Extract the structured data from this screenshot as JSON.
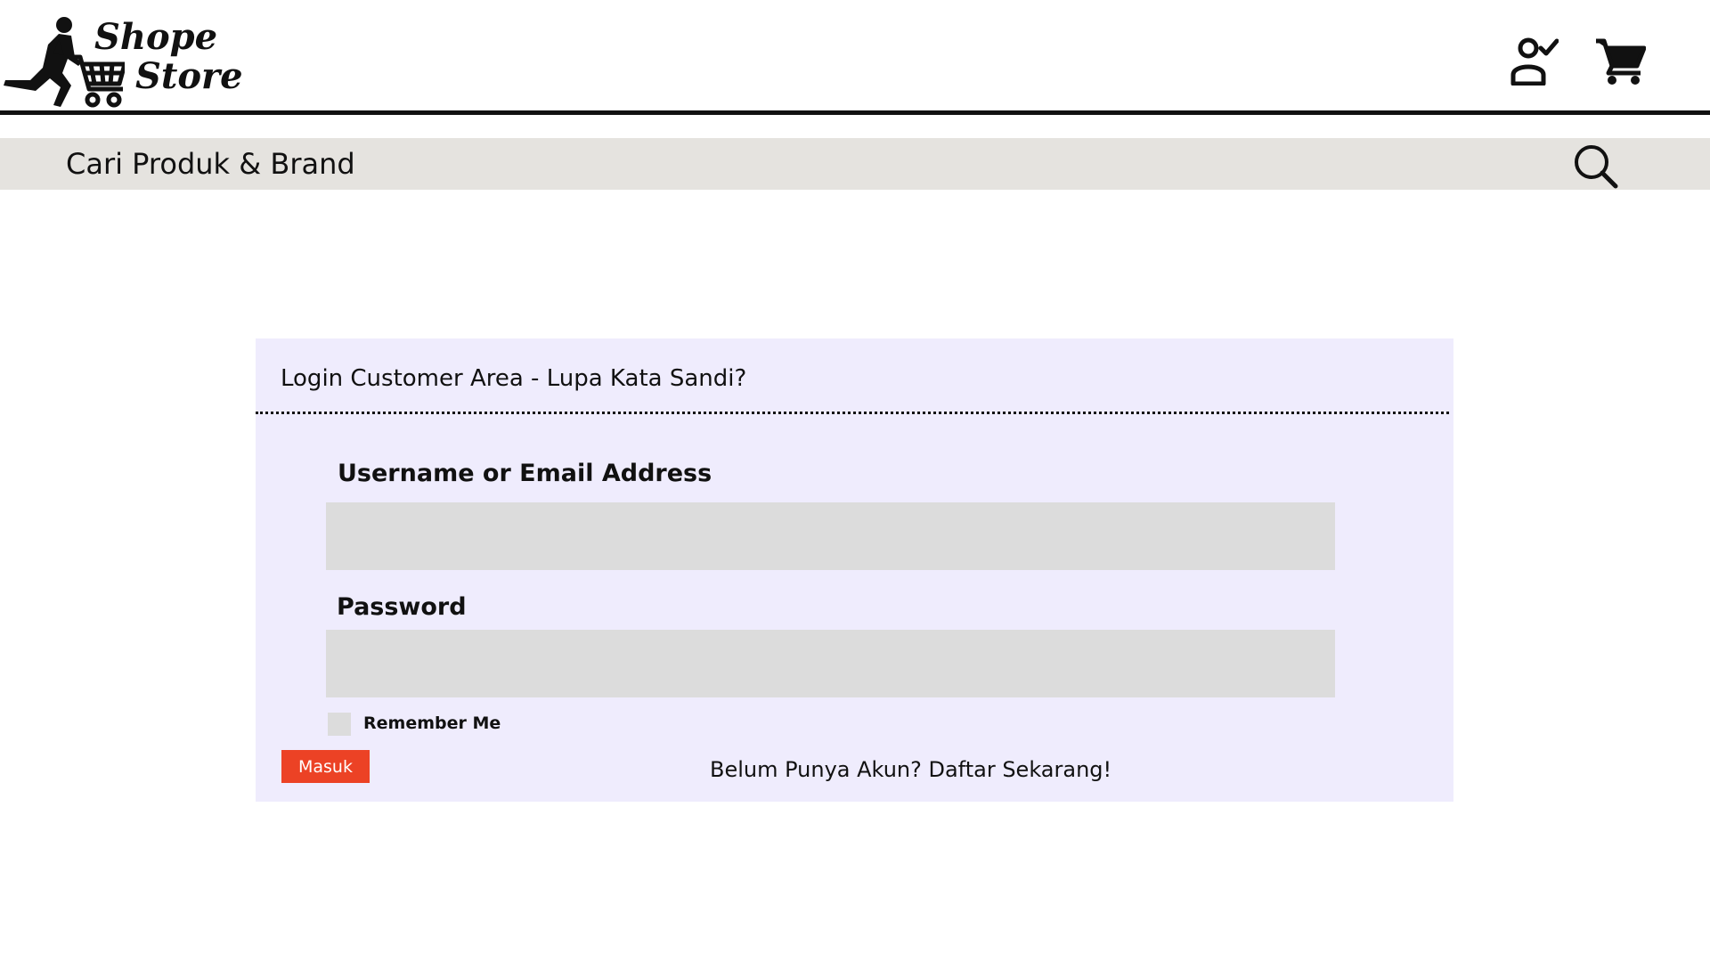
{
  "header": {
    "logo": {
      "line1": "Shope",
      "line2": "Store"
    },
    "icons": {
      "account": "user-check-icon",
      "cart": "shopping-cart-icon"
    }
  },
  "search": {
    "placeholder": "Cari Produk & Brand",
    "icon": "search-icon"
  },
  "login": {
    "title": "Login Customer Area",
    "title_separator": " - ",
    "forgot_link": "Lupa Kata Sandi?",
    "username_label": "Username or Email Address",
    "username_value": "",
    "password_label": "Password",
    "password_value": "",
    "remember_label": "Remember Me",
    "remember_checked": false,
    "submit_label": "Masuk",
    "register_text": "Belum Punya Akun? Daftar Sekarang!"
  },
  "colors": {
    "card_background": "#efecfd",
    "search_bar": "#e5e3df",
    "input_background": "#dcdcdc",
    "button_primary": "#ec4225"
  }
}
